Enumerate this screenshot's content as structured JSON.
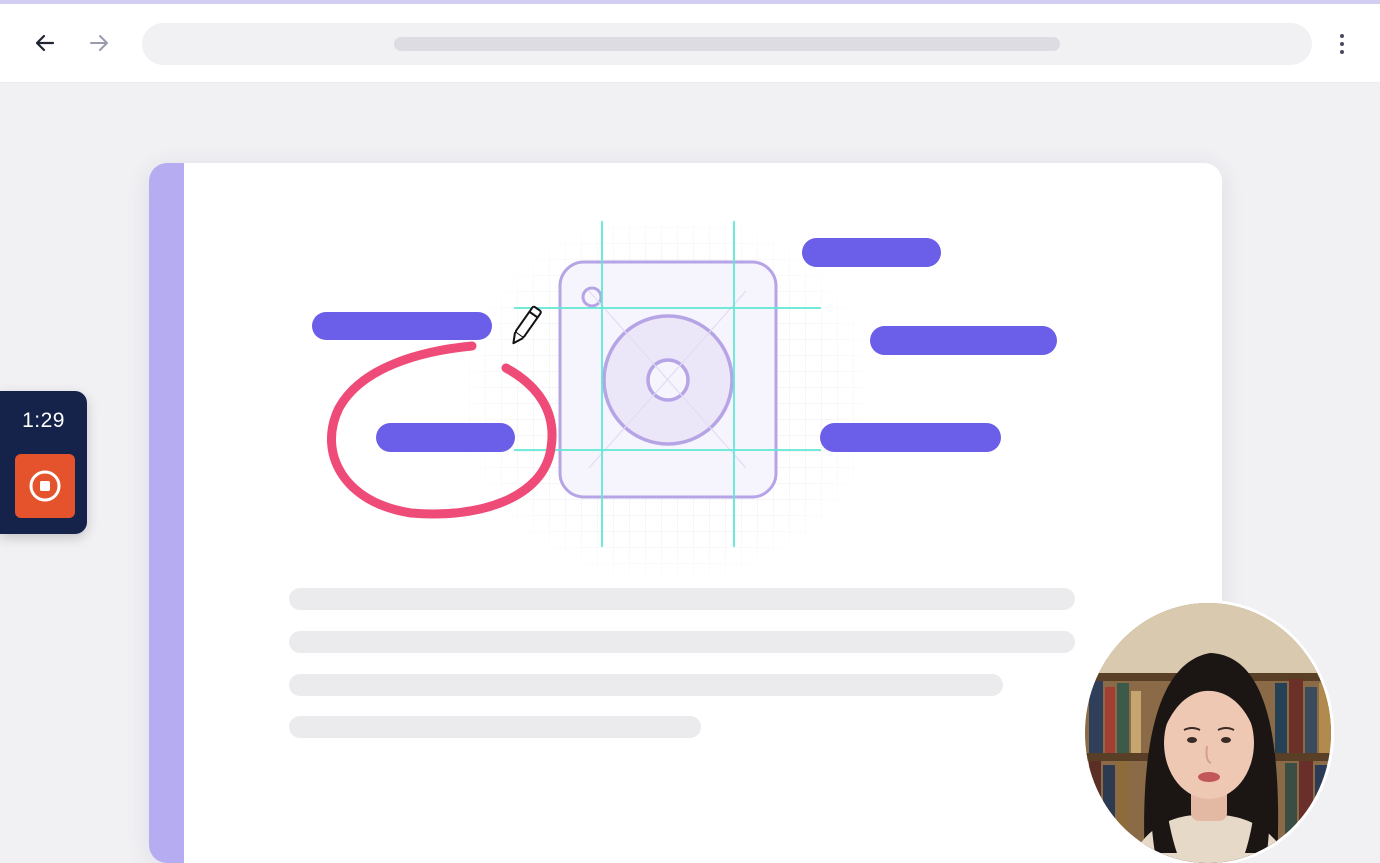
{
  "browser": {
    "back_icon": "arrow-left-icon",
    "forward_icon": "arrow-right-icon",
    "menu_icon": "more-vertical-icon"
  },
  "recorder": {
    "timer": "1:29",
    "stop_icon": "stop-icon",
    "accent": "#e5532d",
    "panel_color": "#15234a"
  },
  "colors": {
    "doc_accent": "#b5acf2",
    "callout_bar": "#6b5ee9",
    "annotation": "#ef4b78",
    "guide": "#5fe8d6",
    "icon_stroke": "#b6a4e6"
  },
  "webcam": {
    "description_icon": "presenter-video-feed"
  }
}
